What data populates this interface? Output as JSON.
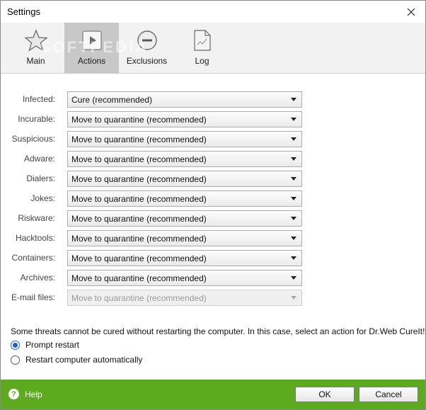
{
  "window": {
    "title": "Settings"
  },
  "watermark": "SOFTPEDIA",
  "tabs": [
    {
      "label": "Main",
      "icon": "star-icon",
      "active": false
    },
    {
      "label": "Actions",
      "icon": "play-icon",
      "active": true
    },
    {
      "label": "Exclusions",
      "icon": "minus-circle-icon",
      "active": false
    },
    {
      "label": "Log",
      "icon": "document-icon",
      "active": false
    }
  ],
  "actions": [
    {
      "label": "Infected:",
      "value": "Cure (recommended)",
      "enabled": true
    },
    {
      "label": "Incurable:",
      "value": "Move to quarantine (recommended)",
      "enabled": true
    },
    {
      "label": "Suspicious:",
      "value": "Move to quarantine (recommended)",
      "enabled": true
    },
    {
      "label": "Adware:",
      "value": "Move to quarantine (recommended)",
      "enabled": true
    },
    {
      "label": "Dialers:",
      "value": "Move to quarantine (recommended)",
      "enabled": true
    },
    {
      "label": "Jokes:",
      "value": "Move to quarantine (recommended)",
      "enabled": true
    },
    {
      "label": "Riskware:",
      "value": "Move to quarantine (recommended)",
      "enabled": true
    },
    {
      "label": "Hacktools:",
      "value": "Move to quarantine (recommended)",
      "enabled": true
    },
    {
      "label": "Containers:",
      "value": "Move to quarantine (recommended)",
      "enabled": true
    },
    {
      "label": "Archives:",
      "value": "Move to quarantine (recommended)",
      "enabled": true
    },
    {
      "label": "E-mail files:",
      "value": "Move to quarantine (recommended)",
      "enabled": false
    }
  ],
  "restart": {
    "note": "Some threats cannot be cured without restarting the computer. In this case, select an action for Dr.Web CureIt!:",
    "options": [
      {
        "label": "Prompt restart",
        "checked": true
      },
      {
        "label": "Restart computer automatically",
        "checked": false
      }
    ]
  },
  "footer": {
    "help_label": "Help",
    "ok_label": "OK",
    "cancel_label": "Cancel"
  },
  "colors": {
    "footer": "#5eaa1e",
    "active_tab": "#c8c8c8",
    "radio_accent": "#1e5fb4"
  }
}
